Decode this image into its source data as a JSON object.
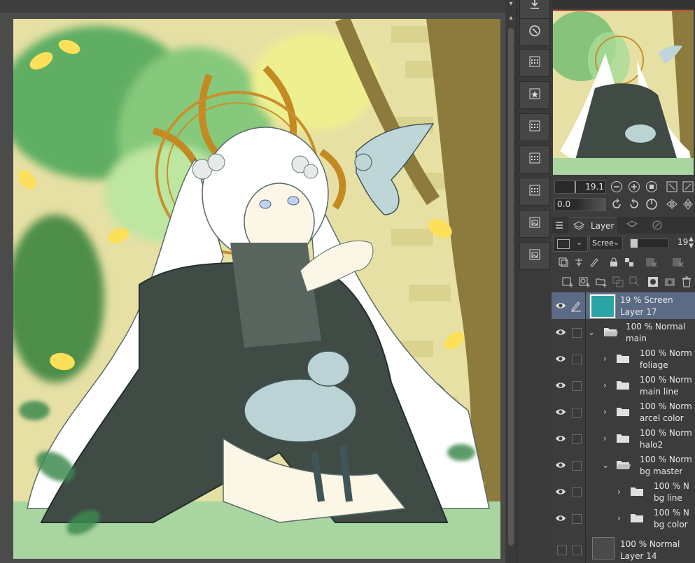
{
  "canvas": {
    "colors": {
      "background": "#e9e5a0",
      "sky": "#f2ee9c",
      "leaf_dark": "#3c8f52",
      "leaf_light": "#fbe35a",
      "gold": "#c78b26",
      "robe": "#3f4a45",
      "skin": "#fbf6e6",
      "hair": "#ffffff",
      "bird": "#bfd6d8",
      "tree": "#8b7d45",
      "grass": "#a8d6a0"
    }
  },
  "toolbar": {
    "buttons": [
      "download-icon",
      "navigator-icon",
      "material-grid-icon",
      "favorite-material-icon",
      "material-grid-icon",
      "material-grid-icon",
      "material-grid-icon",
      "image-material-icon",
      "image-material-icon"
    ]
  },
  "navigator": {
    "zoom_value": "19.1",
    "rotate_value": "0.0"
  },
  "layer_panel": {
    "tab_label": "Layer",
    "blend_mode": "Scree",
    "opacity_value": "19",
    "layers": [
      {
        "percent": "19 % Screen",
        "name": "Layer 17",
        "selected": true,
        "kind": "layer",
        "thumb": "#2aa5a6"
      },
      {
        "percent": "100 % Normal",
        "name": "main",
        "kind": "folder",
        "expanded": true,
        "indent": 0
      },
      {
        "percent": "100 % Norm",
        "name": "foliage",
        "kind": "folder",
        "expanded": false,
        "indent": 1
      },
      {
        "percent": "100 % Norm",
        "name": "main line",
        "kind": "folder",
        "expanded": false,
        "indent": 1
      },
      {
        "percent": "100 % Norm",
        "name": "arcel color",
        "kind": "folder",
        "expanded": false,
        "indent": 1
      },
      {
        "percent": "100 % Norm",
        "name": "halo2",
        "kind": "folder",
        "expanded": false,
        "indent": 1
      },
      {
        "percent": "100 % Norm",
        "name": "bg master",
        "kind": "folder",
        "expanded": true,
        "indent": 1
      },
      {
        "percent": "100 % N",
        "name": "bg line",
        "kind": "folder",
        "expanded": false,
        "indent": 2
      },
      {
        "percent": "100 % N",
        "name": "bg color",
        "kind": "folder",
        "expanded": false,
        "indent": 2
      },
      {
        "percent": "100 % Normal",
        "name": "Layer 14",
        "kind": "layer",
        "thumb": "#4a4a4a"
      }
    ]
  }
}
